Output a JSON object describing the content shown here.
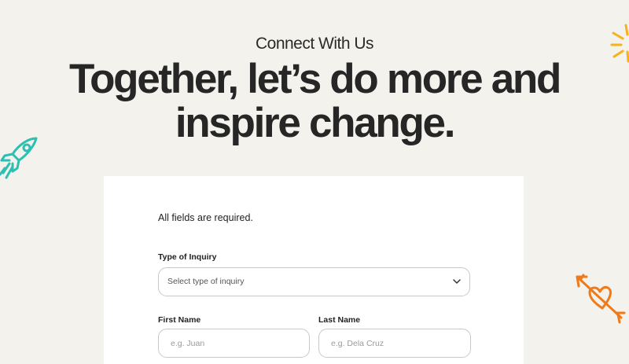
{
  "header": {
    "eyebrow": "Connect With Us",
    "headline_line1": "Together, let’s do more and",
    "headline_line2": "inspire change."
  },
  "form": {
    "required_note": "All fields are required.",
    "inquiry": {
      "label": "Type of Inquiry",
      "placeholder": "Select type of inquiry"
    },
    "first_name": {
      "label": "First Name",
      "placeholder": "e.g. Juan"
    },
    "last_name": {
      "label": "Last Name",
      "placeholder": "e.g. Dela Cruz"
    }
  },
  "icons": {
    "rocket": "rocket-icon",
    "sun": "sun-icon",
    "heart_arrow": "heart-arrow-icon",
    "chevron": "chevron-down-icon"
  },
  "colors": {
    "background": "#f3f2ed",
    "card": "#ffffff",
    "rocket": "#2dbfb2",
    "sun": "#f6b21b",
    "heart": "#f07a1a"
  }
}
